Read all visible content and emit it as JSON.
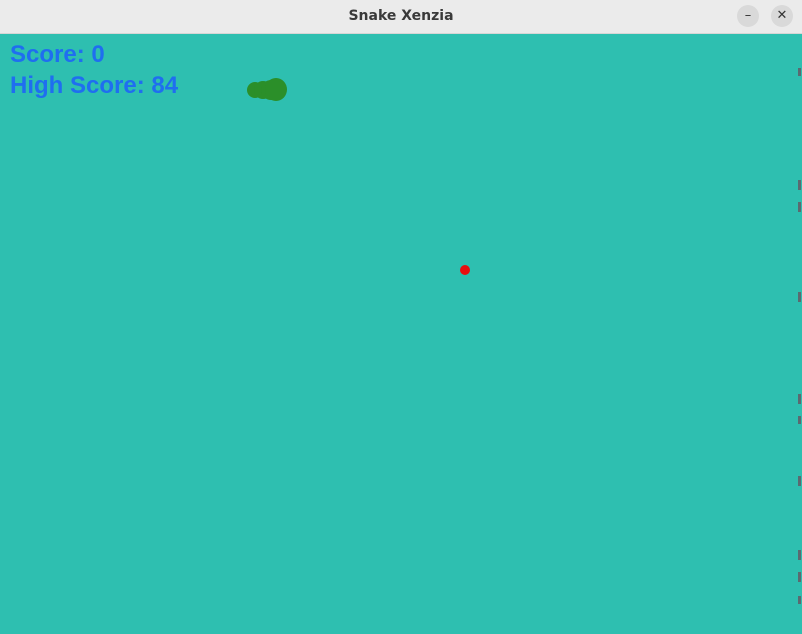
{
  "window": {
    "title": "Snake Xenzia",
    "minimize_icon": "minimize-icon",
    "close_icon": "close-icon",
    "minimize_glyph": "–",
    "close_glyph": "✕"
  },
  "hud": {
    "score_text": "Score: 0",
    "high_score_text": "High Score: 84"
  },
  "colors": {
    "background": "#2ebfb0",
    "snake": "#2b8f29",
    "food": "#e81010",
    "score_text": "#1f6ef0"
  }
}
